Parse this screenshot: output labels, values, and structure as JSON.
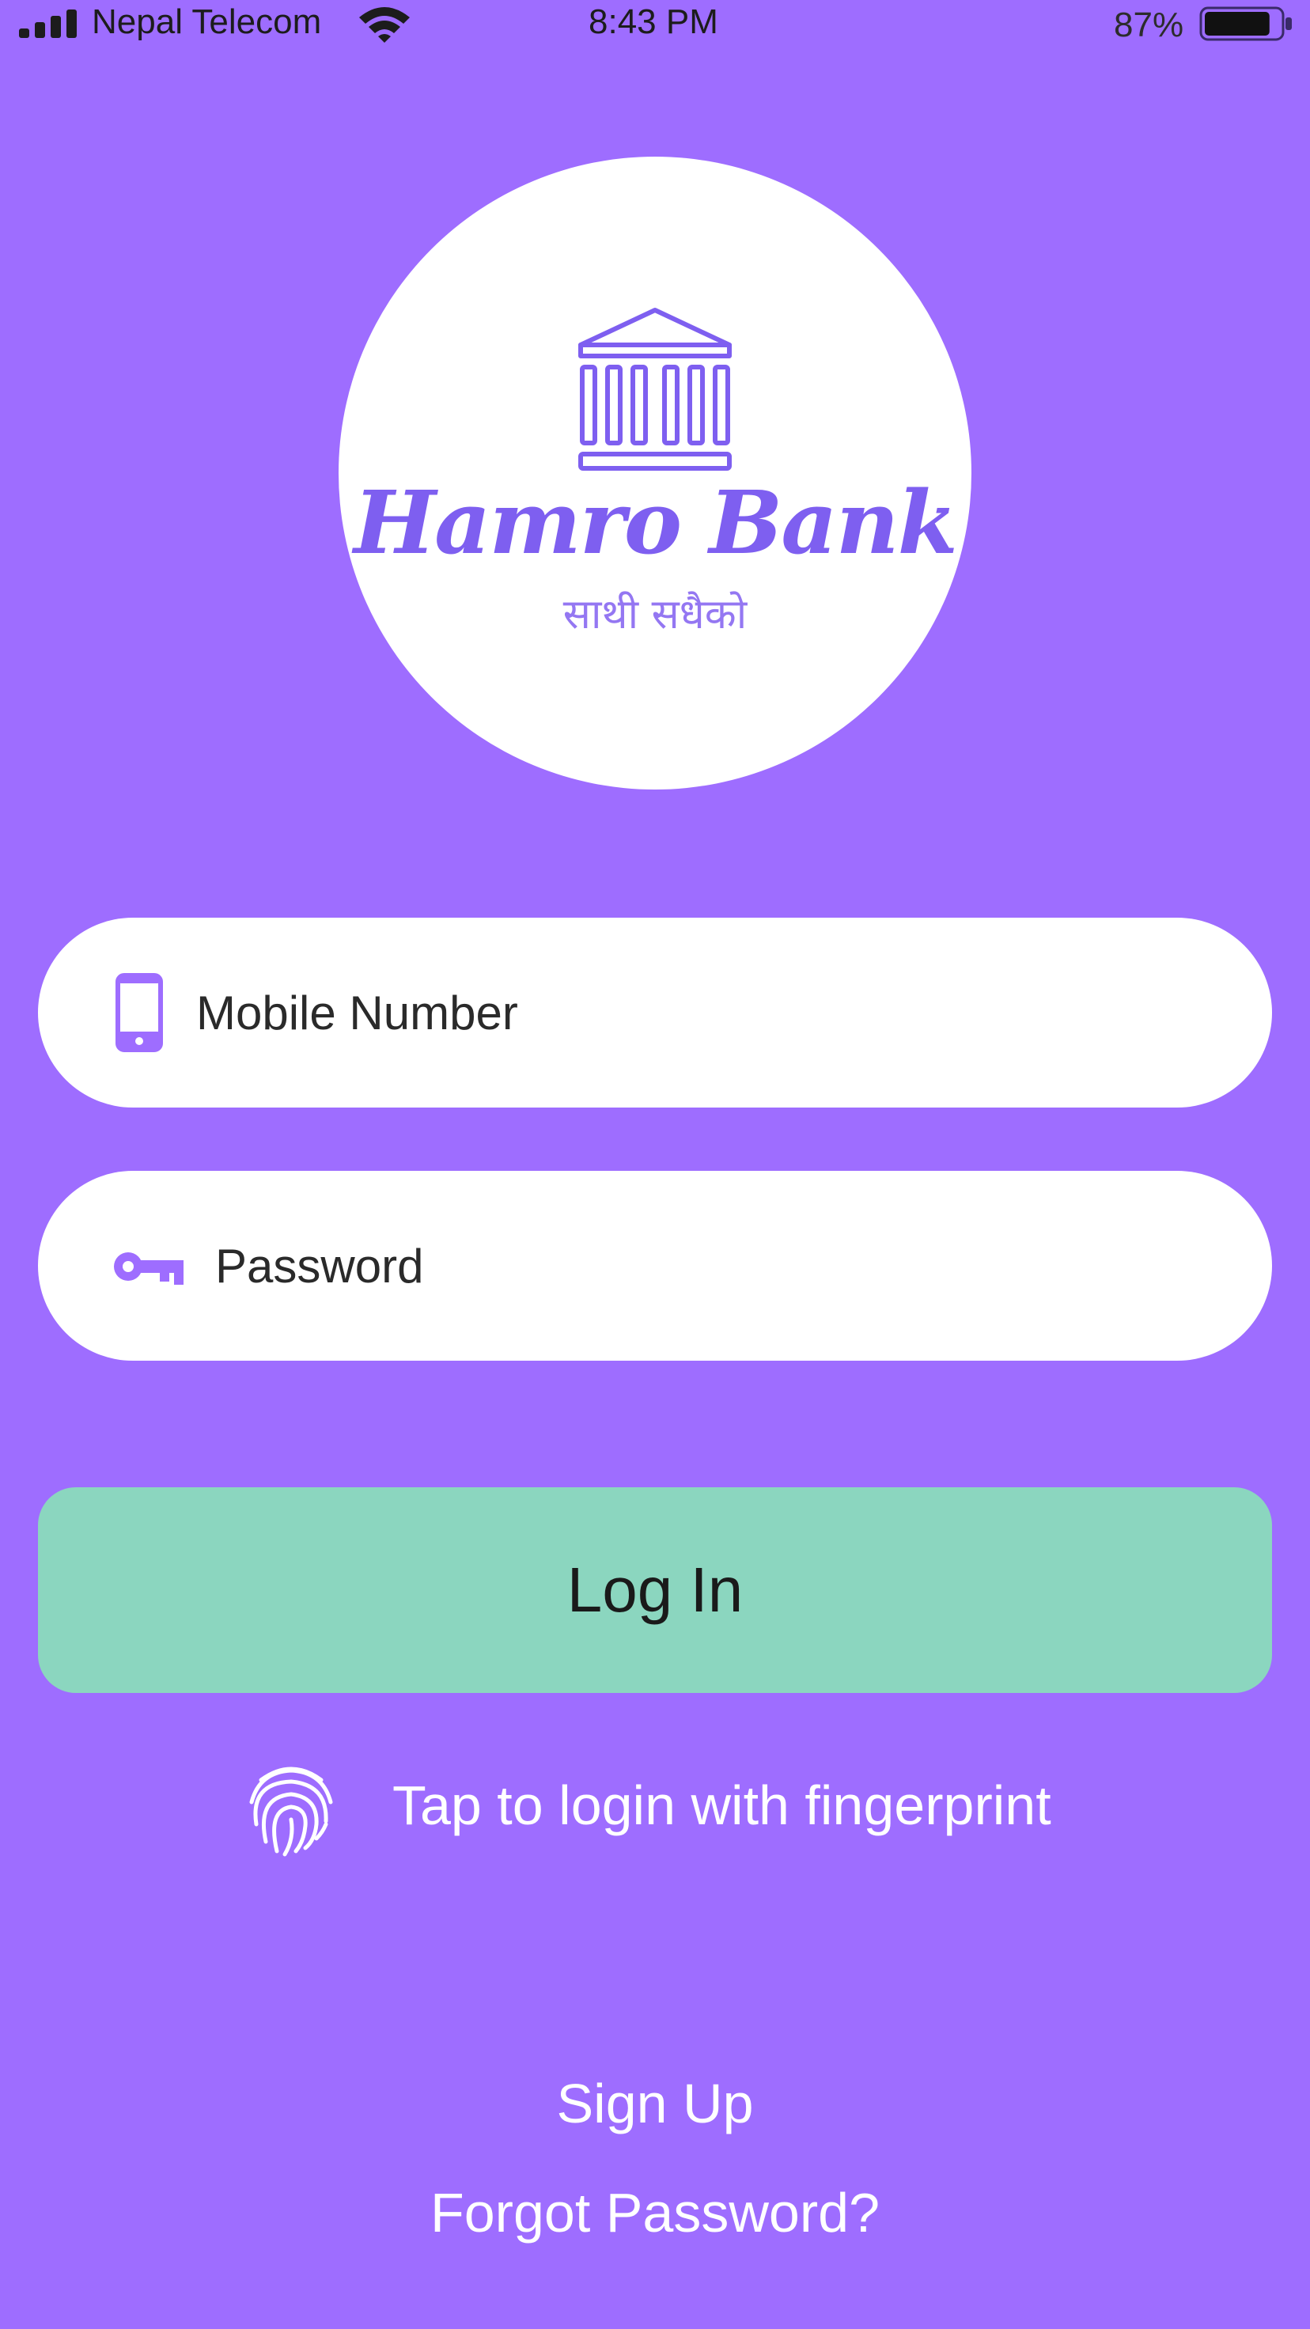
{
  "status_bar": {
    "carrier": "Nepal Telecom",
    "time": "8:43 PM",
    "battery_percent": "87%",
    "signal_icon": "cellular-signal-icon",
    "wifi_icon": "wifi-icon",
    "battery_icon": "battery-icon",
    "battery_level": 0.87
  },
  "branding": {
    "logo_icon": "bank-building-icon",
    "name": "Hamro Bank",
    "tagline": "साथी सधैको"
  },
  "form": {
    "mobile": {
      "icon": "mobile-phone-icon",
      "placeholder": "Mobile Number",
      "value": ""
    },
    "password": {
      "icon": "key-icon",
      "placeholder": "Password",
      "value": ""
    },
    "login_label": "Log In"
  },
  "fingerprint": {
    "icon": "fingerprint-icon",
    "label": "Tap to login with fingerprint"
  },
  "links": {
    "sign_up": "Sign Up",
    "forgot_password": "Forgot Password?"
  },
  "colors": {
    "background": "#9e6dff",
    "accent": "#7e5ff0",
    "login_button": "#8bd6bf",
    "field_background": "#ffffff"
  }
}
